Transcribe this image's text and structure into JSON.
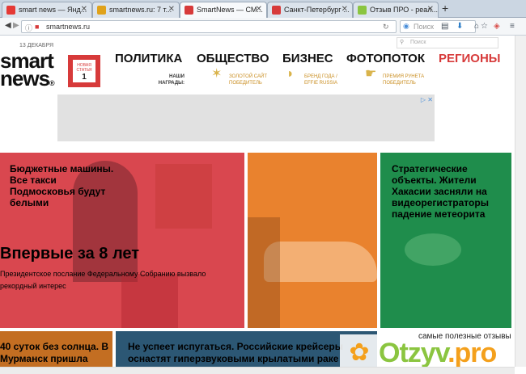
{
  "browser": {
    "tabs": [
      {
        "label": "smart news — Янд...",
        "color": "#e53935"
      },
      {
        "label": "smartnews.ru: 7 т...",
        "color": "#e0a21a"
      },
      {
        "label": "SmartNews — СМ...",
        "color": "#d73a3a"
      },
      {
        "label": "Санкт-Петербург ...",
        "color": "#d73a3a"
      },
      {
        "label": "Отзыв ПРО - реал...",
        "color": "#8bc540"
      }
    ],
    "new_tab": "+",
    "url": "smartnews.ru",
    "search_placeholder": "Поиск",
    "icons": [
      "back-icon",
      "forward-icon",
      "info-icon",
      "reload-icon",
      "star-icon",
      "bookmark-list-icon",
      "download-icon",
      "home-icon",
      "pocket-icon",
      "menu-icon"
    ]
  },
  "site": {
    "date": "13 ДЕКАБРЯ",
    "logo_line1": "smart",
    "logo_line2": "news",
    "logo_mark": "®",
    "search_placeholder": "Поиск",
    "badge_label": "НОВАЯ СТАТЬЯ",
    "badge_count": "1",
    "nav": [
      "ПОЛИТИКА",
      "ОБЩЕСТВО",
      "БИЗНЕС",
      "ФОТОПОТОК",
      "РЕГИОНЫ"
    ],
    "awards_label": "НАШИ НАГРАДЫ:",
    "awards": [
      {
        "line1": "ЗОЛОТОЙ САЙТ",
        "line2": "ПОБЕДИТЕЛЬ"
      },
      {
        "line1": "БРЕНД ГОДА /",
        "line2": "EFFIE RUSSIA"
      },
      {
        "line1": "ПРЕМИЯ РУНЕТА",
        "line2": "ПОБЕДИТЕЛЬ"
      }
    ],
    "ad_icons": "▷ ✕"
  },
  "tiles": {
    "red": {
      "title": "Впервые за 8 лет",
      "subtitle": "Президентское послание Федеральному Собранию вызвало рекордный интерес"
    },
    "orange": {
      "title": "Бюджетные машины. Все такси Подмосковья будут белыми"
    },
    "green": {
      "title": "Стратегические объекты. Жители Хакасии засняли на видеорегистраторы падение метеорита"
    },
    "brown": {
      "title": "40 суток без солнца. В Мурманск пришла"
    },
    "blue": {
      "title": "Не успеет испугаться. Российские крейсеры оснастят гиперзвуковыми крылатыми раке"
    }
  },
  "watermark": {
    "caption": "самые полезные отзывы",
    "logo_main": "Otzyv",
    "logo_suffix": ".pro"
  },
  "colors": {
    "accent_red": "#d73a3a",
    "tile_red": "#d9474f",
    "tile_orange": "#e9822e",
    "tile_green": "#1f8d4c",
    "tile_brown": "#c36e22",
    "tile_blue": "#2c5774"
  }
}
